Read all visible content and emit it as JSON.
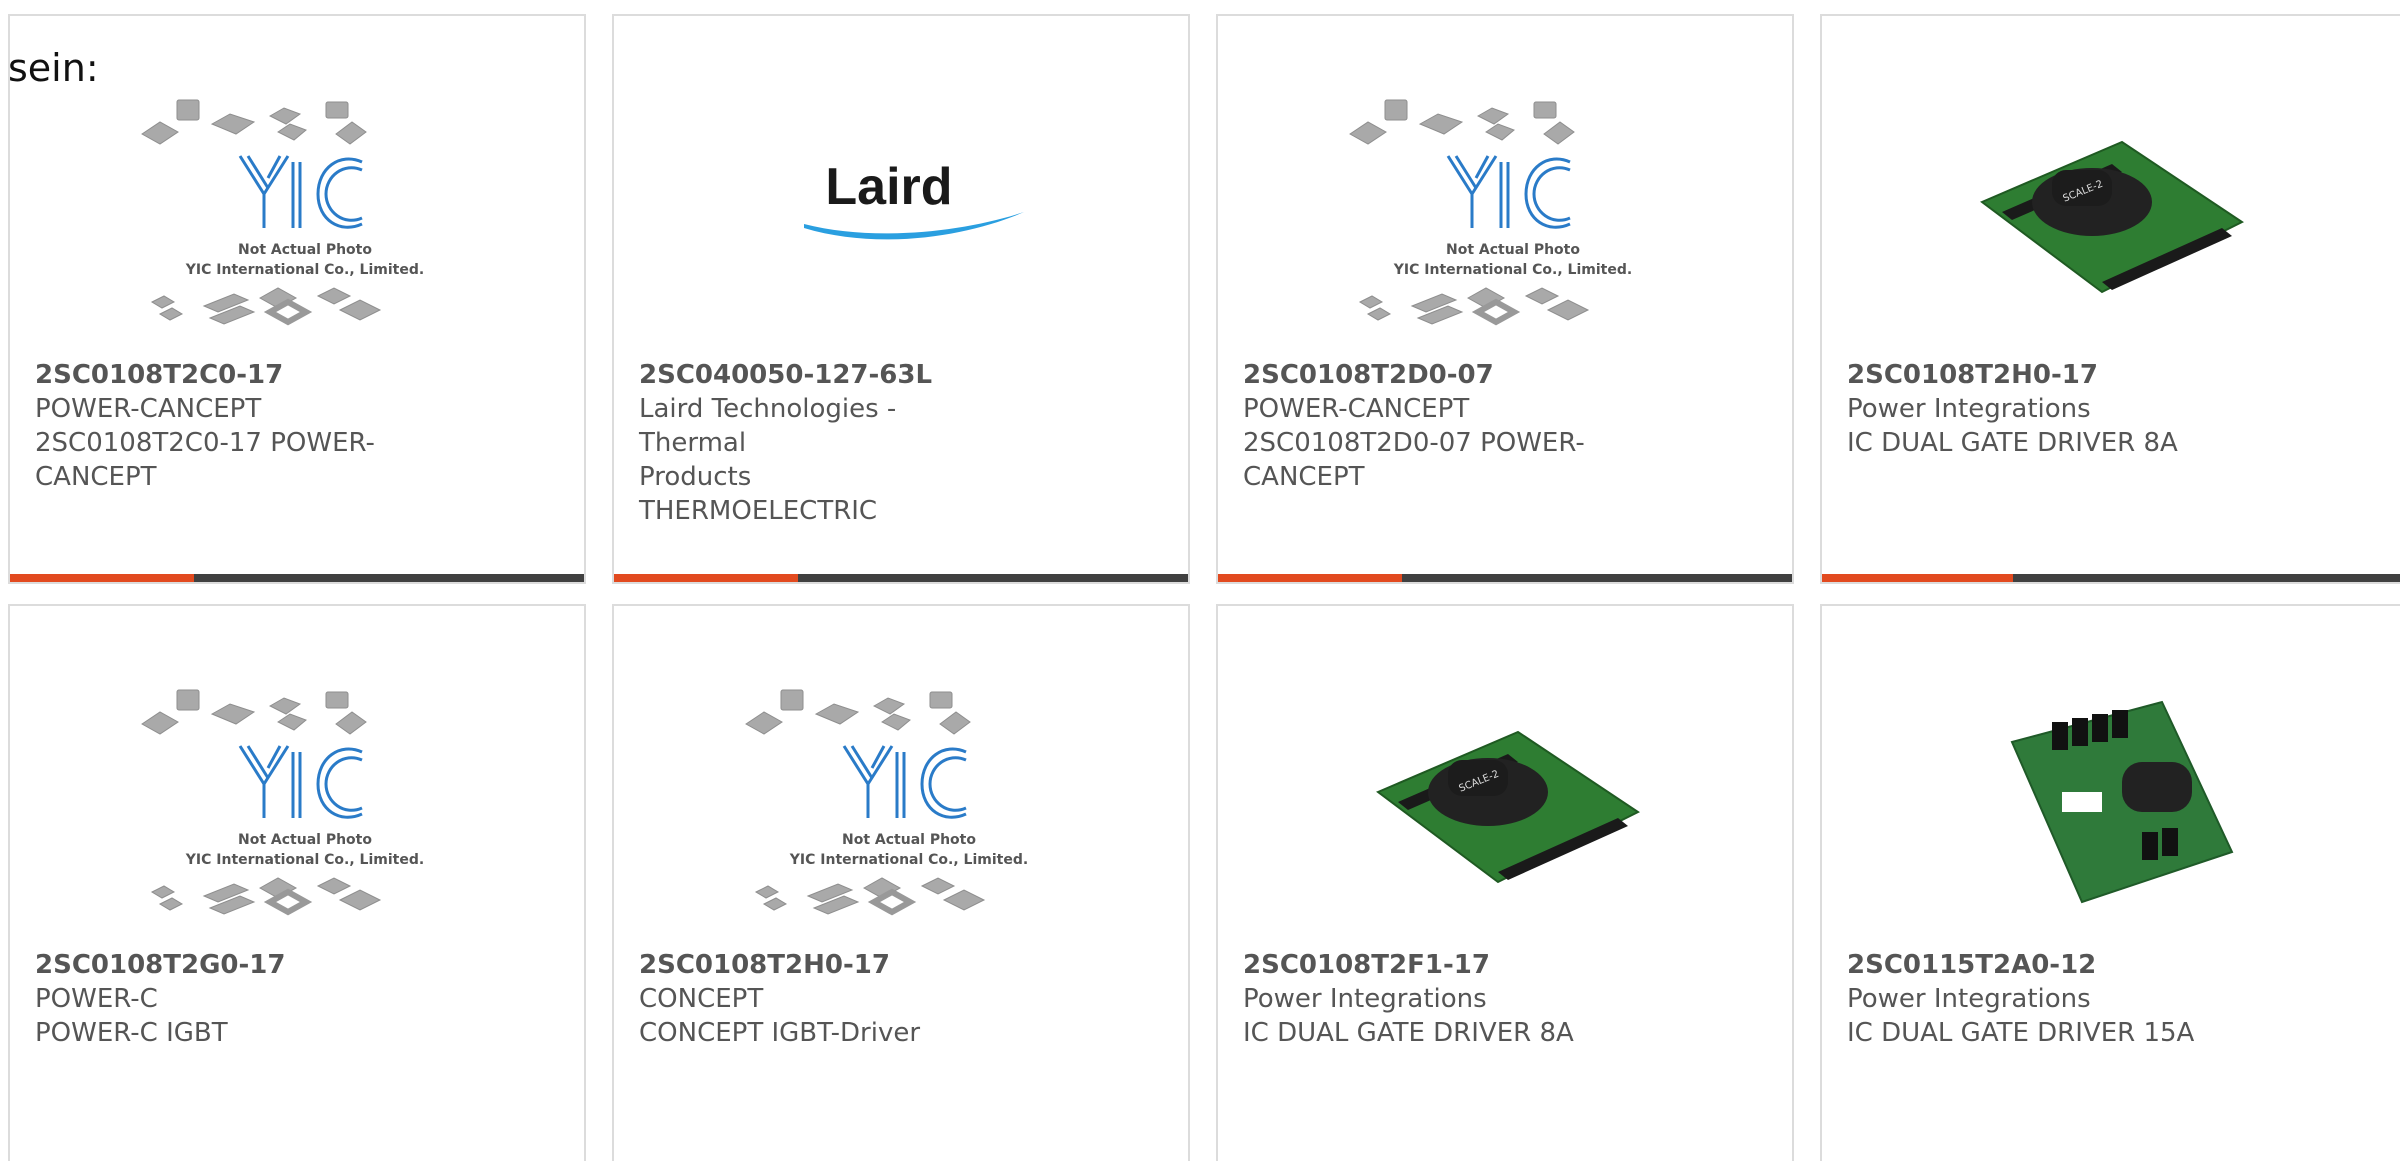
{
  "intro_text": "sein:",
  "accent_color": "#e24a1f",
  "track_color": "#404040",
  "products": [
    {
      "part_number": "2SC0108T2C0-17",
      "manufacturer": "POWER-CANCEPT",
      "description_1": "2SC0108T2C0-17 POWER-",
      "description_2": "CANCEPT",
      "image": "yic-placeholder",
      "placeholder_title": "Not Actual Photo",
      "placeholder_sub": "YIC International Co., Limited.",
      "placeholder_logo": "YIC",
      "progress": 0.32
    },
    {
      "part_number": "2SC040050-127-63L",
      "manufacturer": "Laird Technologies - Thermal",
      "description_1": "Products",
      "description_2": "THERMOELECTRIC",
      "image": "laird-logo",
      "logo_text": "Laird",
      "progress": 0.32
    },
    {
      "part_number": "2SC0108T2D0-07",
      "manufacturer": "POWER-CANCEPT",
      "description_1": "2SC0108T2D0-07 POWER-",
      "description_2": "CANCEPT",
      "image": "yic-placeholder",
      "placeholder_title": "Not Actual Photo",
      "placeholder_sub": "YIC International Co., Limited.",
      "placeholder_logo": "YIC",
      "progress": 0.32
    },
    {
      "part_number": "2SC0108T2H0-17",
      "manufacturer": "Power Integrations",
      "description_1": "IC DUAL GATE DRIVER 8A",
      "description_2": "",
      "image": "pcb-module",
      "progress": 0.32
    },
    {
      "part_number": "2SC0108T2G0-17",
      "manufacturer": "POWER-C",
      "description_1": "POWER-C IGBT",
      "description_2": "",
      "image": "yic-placeholder",
      "placeholder_title": "Not Actual Photo",
      "placeholder_sub": "YIC International Co., Limited.",
      "placeholder_logo": "YIC"
    },
    {
      "part_number": "2SC0108T2H0-17",
      "manufacturer": "CONCEPT",
      "description_1": "CONCEPT IGBT-Driver",
      "description_2": "",
      "image": "yic-placeholder",
      "placeholder_title": "Not Actual Photo",
      "placeholder_sub": "YIC International Co., Limited.",
      "placeholder_logo": "YIC"
    },
    {
      "part_number": "2SC0108T2F1-17",
      "manufacturer": "Power Integrations",
      "description_1": "IC DUAL GATE DRIVER 8A",
      "description_2": "",
      "image": "pcb-module"
    },
    {
      "part_number": "2SC0115T2A0-12",
      "manufacturer": "Power Integrations",
      "description_1": "IC DUAL GATE DRIVER 15A",
      "description_2": "",
      "image": "pcb-module-2"
    }
  ]
}
